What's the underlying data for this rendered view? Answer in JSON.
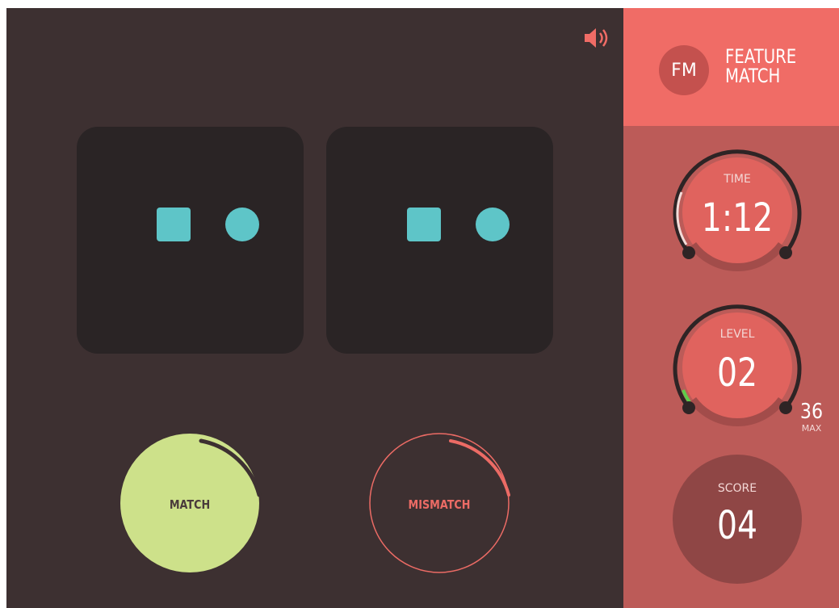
{
  "game": {
    "sound_icon": "speaker-volume-icon",
    "cards": [
      {
        "shapes": [
          "square",
          "circle"
        ],
        "color": "#5ec5c8"
      },
      {
        "shapes": [
          "square",
          "circle"
        ],
        "color": "#5ec5c8"
      }
    ],
    "buttons": {
      "match_label": "MATCH",
      "mismatch_label": "MISMATCH",
      "match_color": "#cde18a",
      "mismatch_color": "#ec6b65"
    }
  },
  "sidebar": {
    "logo": "FM",
    "title_line1": "FEATURE",
    "title_line2": "MATCH",
    "time": {
      "label": "TIME",
      "value": "1:12"
    },
    "level": {
      "label": "LEVEL",
      "value": "02",
      "max_value": "36",
      "max_label": "MAX"
    },
    "score": {
      "label": "SCORE",
      "value": "04"
    }
  },
  "colors": {
    "background": "#3d3031",
    "card": "#2a2425",
    "brand": "#f06c66",
    "sidebar": "#bc5b58",
    "shape": "#5ec5c8"
  }
}
